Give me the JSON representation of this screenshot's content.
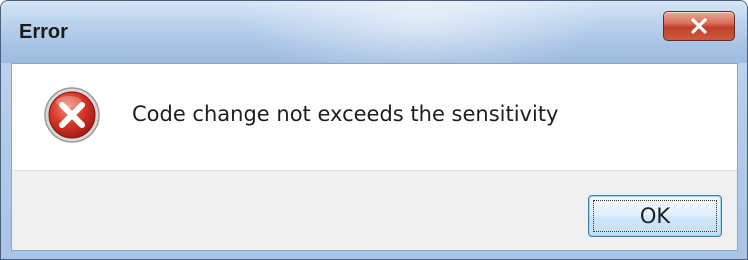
{
  "window": {
    "title": "Error",
    "close_icon": "close-x-icon"
  },
  "message": {
    "icon": "error-icon",
    "text": "Code change not exceeds the sensitivity"
  },
  "buttons": {
    "ok_label": "OK"
  },
  "colors": {
    "titlebar": "#b4cdea",
    "close_button": "#c0412b",
    "error_icon": "#c62a1f",
    "button_area": "#f0f0f0",
    "ok_border": "#3c7fb1"
  }
}
